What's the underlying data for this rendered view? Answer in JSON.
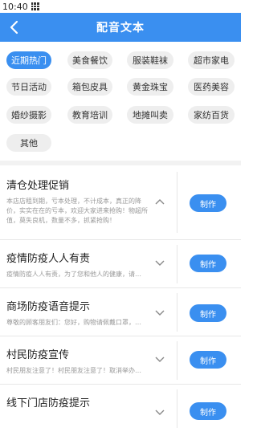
{
  "status_bar": {
    "time": "10:40"
  },
  "header": {
    "title": "配音文本"
  },
  "categories": [
    {
      "label": "近期热门",
      "active": true
    },
    {
      "label": "美食餐饮"
    },
    {
      "label": "服装鞋袜"
    },
    {
      "label": "超市家电"
    },
    {
      "label": "节日活动"
    },
    {
      "label": "箱包皮具"
    },
    {
      "label": "黄金珠宝"
    },
    {
      "label": "医药美容"
    },
    {
      "label": "婚纱摄影"
    },
    {
      "label": "教育培训"
    },
    {
      "label": "地摊叫卖"
    },
    {
      "label": "家纺百货"
    },
    {
      "label": "其他"
    }
  ],
  "items": [
    {
      "title": "清仓处理促销",
      "desc": "本店店租到期，亏本处理，不计成本，真正的降价，实实在在的亏本，欢迎大家进来抢购！物超所值，莫失良机，数量不多，抓紧抢购！",
      "button": "制作",
      "expanded": true
    },
    {
      "title": "疫情防疫人人有责",
      "desc": "疫情防疫人人有责，为了您和他人的健康，请…",
      "button": "制作",
      "expanded": false
    },
    {
      "title": "商场防疫语音提示",
      "desc": "尊敬的顾客朋友们：您好，购物请佩戴口罩，…",
      "button": "制作",
      "expanded": false
    },
    {
      "title": "村民防疫宣传",
      "desc": "村民朋友注意了！村民朋友注意了！取消举办…",
      "button": "制作",
      "expanded": false
    },
    {
      "title": "线下门店防疫提示",
      "desc": "",
      "button": "制作",
      "expanded": false
    }
  ]
}
